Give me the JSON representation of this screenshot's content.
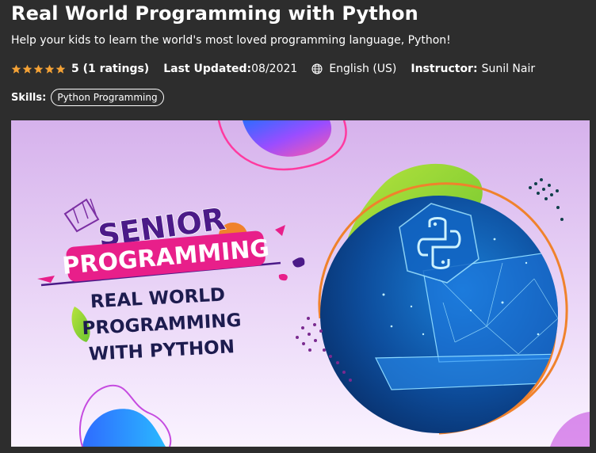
{
  "course": {
    "title": "Real World Programming with Python",
    "subtitle": "Help your kids to learn the world's most loved programming language, Python!",
    "rating_text": "5 (1 ratings)",
    "rating_value": 5,
    "rating_max": 5,
    "last_updated_label": "Last Updated:",
    "last_updated_value": "08/2021",
    "language": "English (US)",
    "instructor_label": "Instructor:",
    "instructor_name": "Sunil Nair",
    "skills_label": "Skills:",
    "skills": [
      "Python Programming"
    ]
  },
  "banner": {
    "line1": "SENIOR",
    "line2": "PROGRAMMING",
    "line3": "REAL WORLD",
    "line4": "PROGRAMMING",
    "line5": "WITH PYTHON"
  },
  "colors": {
    "page_bg": "#2d2d2d",
    "star": "#f4a236",
    "banner_bg_top": "#d9b8ee",
    "banner_bg_bottom": "#faf2ff",
    "senior_text": "#4b1a88",
    "programming_pill": "#e81f8a",
    "navy_text": "#1d1c4f",
    "circle_blue": "#0e4ea0",
    "orange_ring": "#f0822c",
    "lime": "#8fd13a"
  },
  "icons": {
    "star": "star-icon",
    "globe": "globe-icon"
  }
}
